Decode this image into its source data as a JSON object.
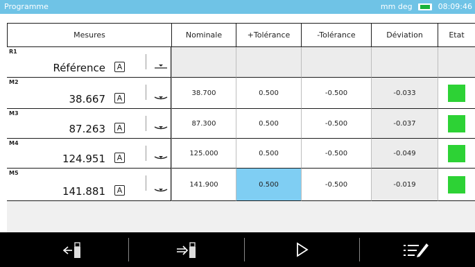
{
  "title": "Programme",
  "status": {
    "units": "mm deg",
    "time": "08:09:46"
  },
  "headers": {
    "mesures": "Mesures",
    "nominal": "Nominale",
    "plus_tol": "+Tolérance",
    "minus_tol": "-Tolérance",
    "deviation": "Déviation",
    "etat": "Etat"
  },
  "rows": [
    {
      "id": "R1",
      "value": "Référence",
      "mode": "A",
      "nominal": "",
      "plus_tol": "",
      "minus_tol": "",
      "deviation": "",
      "etat": ""
    },
    {
      "id": "M2",
      "value": "38.667",
      "mode": "A",
      "nominal": "38.700",
      "plus_tol": "0.500",
      "minus_tol": "-0.500",
      "deviation": "-0.033",
      "etat": "ok"
    },
    {
      "id": "M3",
      "value": "87.263",
      "mode": "A",
      "nominal": "87.300",
      "plus_tol": "0.500",
      "minus_tol": "-0.500",
      "deviation": "-0.037",
      "etat": "ok"
    },
    {
      "id": "M4",
      "value": "124.951",
      "mode": "A",
      "nominal": "125.000",
      "plus_tol": "0.500",
      "minus_tol": "-0.500",
      "deviation": "-0.049",
      "etat": "ok"
    },
    {
      "id": "M5",
      "value": "141.881",
      "mode": "A",
      "nominal": "141.900",
      "plus_tol": "0.500",
      "minus_tol": "-0.500",
      "deviation": "-0.019",
      "etat": "ok"
    }
  ],
  "colors": {
    "titlebar": "#6fc3e6",
    "ok": "#2dd235",
    "selected": "#7fcef3",
    "toolbar": "#000000"
  },
  "toolbar_icons": [
    "usb-import-icon",
    "usb-export-icon",
    "play-icon",
    "edit-list-icon"
  ]
}
